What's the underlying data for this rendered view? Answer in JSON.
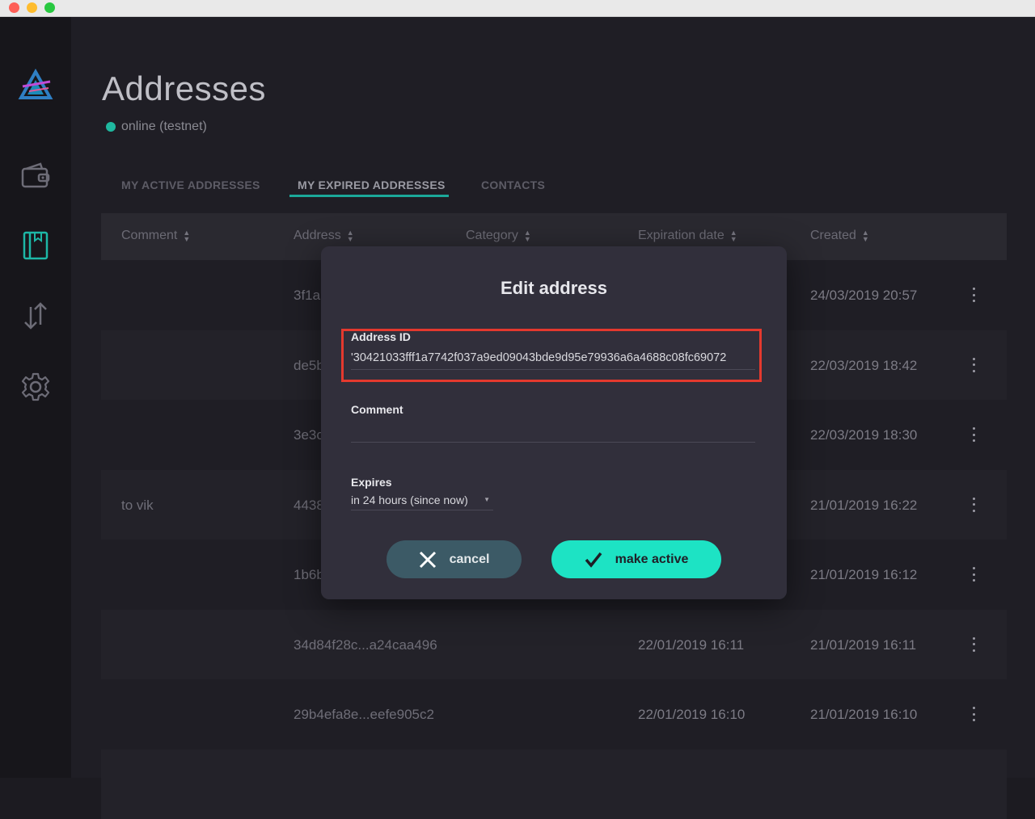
{
  "window": {
    "title": ""
  },
  "page": {
    "title": "Addresses",
    "status": "online (testnet)"
  },
  "tabs": [
    {
      "label": "MY ACTIVE ADDRESSES",
      "active": false
    },
    {
      "label": "MY EXPIRED ADDRESSES",
      "active": true
    },
    {
      "label": "CONTACTS",
      "active": false
    }
  ],
  "table": {
    "columns": [
      "Comment",
      "Address",
      "Category",
      "Expiration date",
      "Created"
    ],
    "rows": [
      {
        "comment": "",
        "address": "3f1a",
        "category": "",
        "expiration": "",
        "created": "24/03/2019 20:57"
      },
      {
        "comment": "",
        "address": "de5b",
        "category": "",
        "expiration": "",
        "created": "22/03/2019 18:42"
      },
      {
        "comment": "",
        "address": "3e3c",
        "category": "",
        "expiration": "",
        "created": "22/03/2019 18:30"
      },
      {
        "comment": "to vik",
        "address": "4438",
        "category": "",
        "expiration": "",
        "created": "21/01/2019 16:22"
      },
      {
        "comment": "",
        "address": "1b6b",
        "category": "",
        "expiration": "",
        "created": "21/01/2019 16:12"
      },
      {
        "comment": "",
        "address": "34d84f28c...a24caa496",
        "category": "",
        "expiration": "22/01/2019 16:11",
        "created": "21/01/2019 16:11"
      },
      {
        "comment": "",
        "address": "29b4efa8e...eefe905c2",
        "category": "",
        "expiration": "22/01/2019 16:10",
        "created": "21/01/2019 16:10"
      },
      {
        "comment": "",
        "address": "",
        "category": "",
        "expiration": "",
        "created": ""
      }
    ]
  },
  "modal": {
    "title": "Edit address",
    "address_label": "Address ID",
    "address_value": "'30421033fff1a7742f037a9ed09043bde9d95e79936a6a4688c08fc69072",
    "comment_label": "Comment",
    "comment_value": "",
    "expires_label": "Expires",
    "expires_value": "in 24 hours (since now)",
    "cancel_label": "cancel",
    "make_active_label": "make active"
  },
  "sidebar": {
    "items": [
      "logo-icon",
      "wallet-icon",
      "addresses-icon",
      "transactions-icon",
      "settings-icon"
    ],
    "active": "addresses-icon"
  },
  "colors": {
    "accent": "#1de3c4",
    "active_tab_underline": "#1ba899",
    "status_online": "#1fb89f",
    "highlight": "#e4392e",
    "cancel_button": "#3c5a66"
  }
}
